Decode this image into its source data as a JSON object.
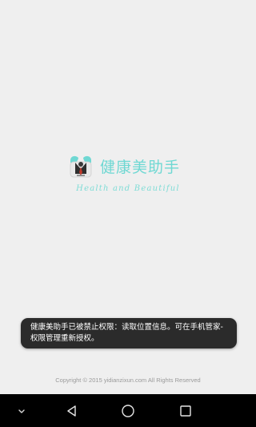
{
  "app": {
    "name": "健康美助手",
    "tagline": "Health and Beautiful"
  },
  "toast": {
    "message": "健康美助手已被禁止权限：读取位置信息。可在手机管家-权限管理重新授权。"
  },
  "footer": {
    "copyright": "Copyright © 2015 yidianzixun.com All Rights Reserved"
  },
  "colors": {
    "accent": "#6fd8d3",
    "background": "#efefef",
    "toast_bg": "#2b2b2b",
    "navbar_bg": "#000000"
  },
  "icons": {
    "logo": "app-logo-icon",
    "nav_down": "chevron-down-icon",
    "nav_back": "back-triangle-icon",
    "nav_home": "home-circle-icon",
    "nav_recent": "recent-square-icon"
  }
}
